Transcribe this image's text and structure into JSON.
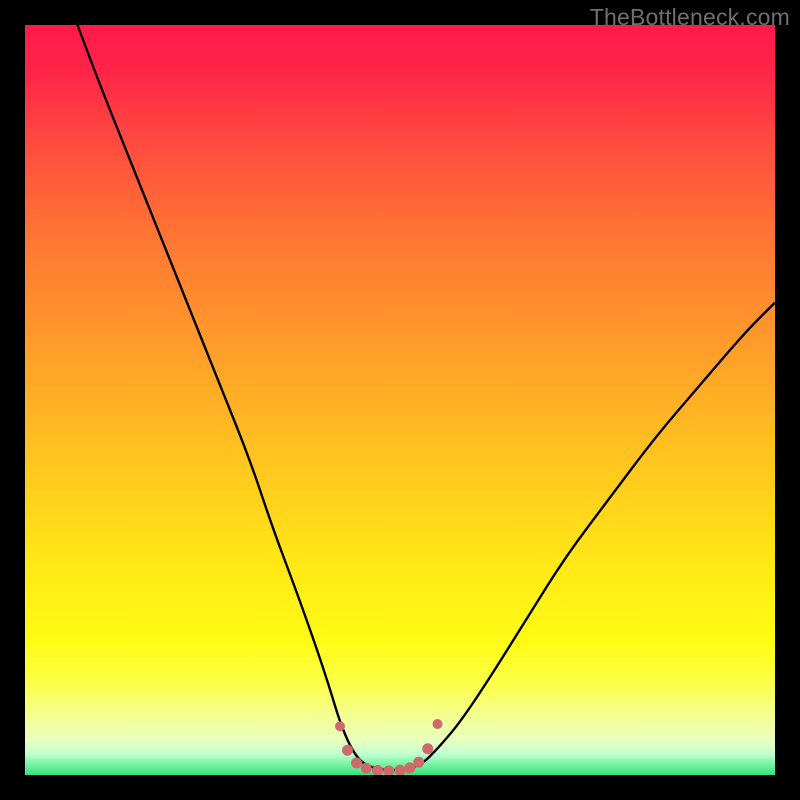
{
  "watermark": "TheBottleneck.com",
  "colors": {
    "black": "#000000",
    "curve": "#000000",
    "markers": "#cf6a6c",
    "bottom_band": "#2fe47e"
  },
  "gradient_stops": [
    {
      "offset": 0.0,
      "color": "#ff1a4b"
    },
    {
      "offset": 0.06,
      "color": "#ff2448"
    },
    {
      "offset": 0.15,
      "color": "#ff4840"
    },
    {
      "offset": 0.28,
      "color": "#ff7534"
    },
    {
      "offset": 0.42,
      "color": "#ff9a2a"
    },
    {
      "offset": 0.58,
      "color": "#ffc51f"
    },
    {
      "offset": 0.72,
      "color": "#ffe816"
    },
    {
      "offset": 0.82,
      "color": "#fffb14"
    },
    {
      "offset": 0.88,
      "color": "#fbff4a"
    },
    {
      "offset": 0.92,
      "color": "#f4ff90"
    },
    {
      "offset": 0.955,
      "color": "#e8ffc0"
    },
    {
      "offset": 0.972,
      "color": "#c0ffcf"
    },
    {
      "offset": 0.985,
      "color": "#7af4a4"
    },
    {
      "offset": 1.0,
      "color": "#2fe47e"
    }
  ],
  "chart_data": {
    "type": "line",
    "title": "",
    "xlabel": "",
    "ylabel": "",
    "xlim": [
      0,
      100
    ],
    "ylim": [
      0,
      100
    ],
    "series": [
      {
        "name": "bottleneck-curve",
        "x": [
          7,
          10,
          14,
          18,
          22,
          26,
          30,
          33,
          36,
          38.5,
          40.5,
          42,
          43.5,
          45,
          47,
          49,
          51,
          53,
          55,
          58,
          62,
          67,
          72,
          78,
          84,
          90,
          96,
          100
        ],
        "y": [
          100,
          92,
          82,
          72,
          62,
          52,
          42,
          33,
          25,
          18,
          12,
          7,
          3.5,
          1.5,
          0.8,
          0.6,
          0.8,
          1.5,
          3.5,
          7,
          13,
          21,
          29,
          37,
          45,
          52,
          59,
          63
        ]
      }
    ],
    "markers": {
      "name": "optimal-zone",
      "x": [
        42,
        43,
        44.2,
        45.5,
        47,
        48.5,
        50,
        51.3,
        52.5,
        53.7,
        55
      ],
      "y": [
        6.5,
        3.3,
        1.6,
        0.9,
        0.6,
        0.55,
        0.65,
        0.95,
        1.7,
        3.5,
        6.8
      ],
      "r": [
        5,
        5.5,
        5.5,
        5.5,
        5.5,
        5.5,
        5.5,
        5.5,
        5.5,
        5.5,
        5
      ]
    }
  }
}
